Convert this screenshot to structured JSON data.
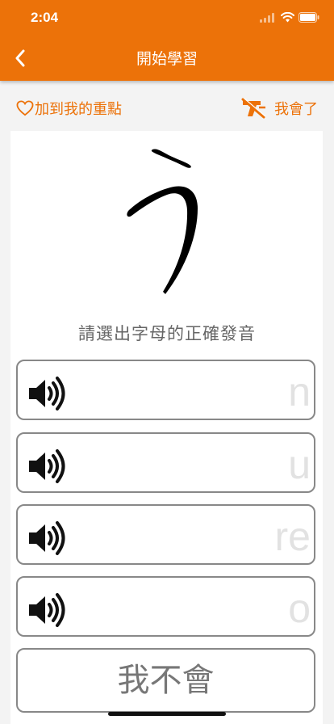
{
  "status_bar": {
    "time": "2:04"
  },
  "header": {
    "title": "開始學習"
  },
  "toolbar": {
    "favorite_label": "加到我的重點",
    "known_label": "我會了"
  },
  "question": {
    "character": "う",
    "prompt": "請選出字母的正確發音"
  },
  "options": [
    {
      "label": "n"
    },
    {
      "label": "u"
    },
    {
      "label": "re"
    },
    {
      "label": "o"
    }
  ],
  "dont_know_label": "我不會",
  "colors": {
    "accent": "#ec7209",
    "option_border": "#888888"
  },
  "icons": [
    "back-chevron-icon",
    "heart-outline-icon",
    "crossed-marker-icon",
    "speaker-icon",
    "signal-icon",
    "wifi-icon",
    "battery-icon"
  ]
}
